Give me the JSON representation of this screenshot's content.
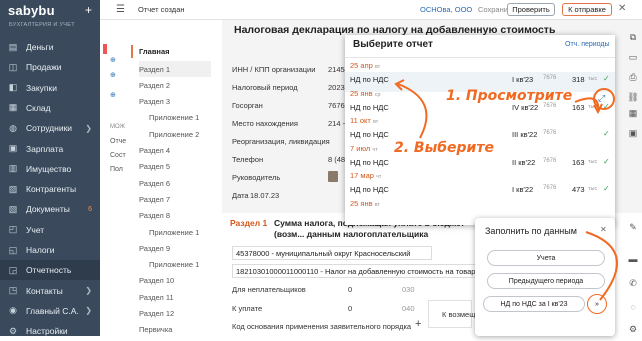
{
  "nav": {
    "logo": "sabybu",
    "subtitle": "БУХГАЛТЕРИЯ И УЧЕТ",
    "items": [
      {
        "label": "Деньги",
        "icon": "money-icon"
      },
      {
        "label": "Продажи",
        "icon": "sales-icon"
      },
      {
        "label": "Закупки",
        "icon": "cart-icon"
      },
      {
        "label": "Склад",
        "icon": "warehouse-icon"
      },
      {
        "label": "Сотрудники",
        "icon": "people-icon",
        "chevron": "❯"
      },
      {
        "label": "Зарплата",
        "icon": "wallet-icon"
      },
      {
        "label": "Имущество",
        "icon": "property-icon"
      },
      {
        "label": "Контрагенты",
        "icon": "contractors-icon"
      },
      {
        "label": "Документы",
        "icon": "documents-icon",
        "badge": "6"
      },
      {
        "label": "Учет",
        "icon": "accounting-icon"
      },
      {
        "label": "Налоги",
        "icon": "taxes-icon"
      },
      {
        "label": "Отчетность",
        "icon": "reports-icon"
      },
      {
        "label": "Контакты",
        "icon": "contacts-icon",
        "chevron": "❯"
      },
      {
        "label": "Главный С.А.",
        "icon": "user-icon",
        "chevron": "❯"
      },
      {
        "label": "Настройки",
        "icon": "settings-icon"
      }
    ]
  },
  "topbar": {
    "status": "Отчет создан",
    "org": "ОСНОва, ООО",
    "save": "Сохранить",
    "check": "Проверить",
    "send": "К отправке"
  },
  "bg_menu": {
    "items": [
      "МОЖ",
      "Отче",
      "Сост",
      "Пол"
    ]
  },
  "sections": {
    "main": "Главная",
    "items": [
      "Раздел 1",
      "Раздел 2",
      "Раздел 3",
      "Приложение 1",
      "Приложение 2",
      "Раздел 4",
      "Раздел 5",
      "Раздел 6",
      "Раздел 7",
      "Раздел 8",
      "Приложение 1",
      "Раздел 9",
      "Приложение 1",
      "Раздел 10",
      "Раздел 11",
      "Раздел 12",
      "Первичка"
    ]
  },
  "doc": {
    "title": "Налоговая декларация по налогу на добавленную стоимость",
    "inn_label": "ИНН / КПП организации",
    "inn_value": "21454",
    "period_label": "Налоговый период",
    "period_value": "2023",
    "gosorgan_label": "Госорган",
    "gosorgan_value": "7676",
    "place_label": "Место нахождения",
    "place_value": "214 -",
    "reorg_label": "Реорганизация, ликвидация",
    "phone_label": "Телефон",
    "phone_value": "8 (48",
    "head_label": "Руководитель",
    "date_label": "Дата",
    "date_value": "18.07.23",
    "section1_prefix": "Раздел 1",
    "section1_title": "Сумма налога, подлежащая уплате в бюджет (возм... данным налогоплательщика",
    "oktmo": "45378000 - муниципальный округ Красносельский",
    "kbk": "18210301000011000110 - Налог на добавленную стоимость на товары",
    "nonpayers_label": "Для неплательщиков",
    "nonpayers_value": "0",
    "nonpayers_code": "030",
    "topay_label": "К уплате",
    "topay_value": "0",
    "topay_code": "040",
    "refund_label": "К возмещ",
    "basis_label": "Код основания применения заявительного порядка"
  },
  "popup": {
    "title": "Выберите отчет",
    "other": "Отч. периоды",
    "rows": [
      {
        "date": "25 апр",
        "dow": "вт",
        "name": "НД по НДС",
        "period": "I кв'23",
        "code": "7676",
        "sum": "318",
        "unit": "тыс"
      },
      {
        "date": "25 янв",
        "dow": "ср",
        "name": "НД по НДС",
        "period": "IV кв'22",
        "code": "7676",
        "sum": "163",
        "unit": "тыс"
      },
      {
        "date": "11 окт",
        "dow": "вт",
        "name": "НД по НДС",
        "period": "III кв'22",
        "code": "7676",
        "sum": "",
        "unit": ""
      },
      {
        "date": "7 июл",
        "dow": "чт",
        "name": "НД по НДС",
        "period": "II кв'22",
        "code": "7676",
        "sum": "163",
        "unit": "тыс"
      },
      {
        "date": "17 мар",
        "dow": "чт",
        "name": "НД по НДС",
        "period": "I кв'22",
        "code": "7676",
        "sum": "473",
        "unit": "тыс"
      },
      {
        "date": "25 янв",
        "dow": "вт",
        "name": "",
        "period": "",
        "code": "",
        "sum": "",
        "unit": ""
      }
    ]
  },
  "fill": {
    "title": "Заполнить по данным",
    "opt1": "Учета",
    "opt2": "Предыдущего периода",
    "opt3": "НД по НДС за I кв'23",
    "more": "»"
  },
  "annotations": {
    "a1": "1. Просмотрите",
    "a2": "2. Выберите"
  },
  "colors": {
    "accent": "#f06a22",
    "nav": "#3a4a5c",
    "link": "#2b6bb3",
    "ok": "#3aa05a"
  }
}
